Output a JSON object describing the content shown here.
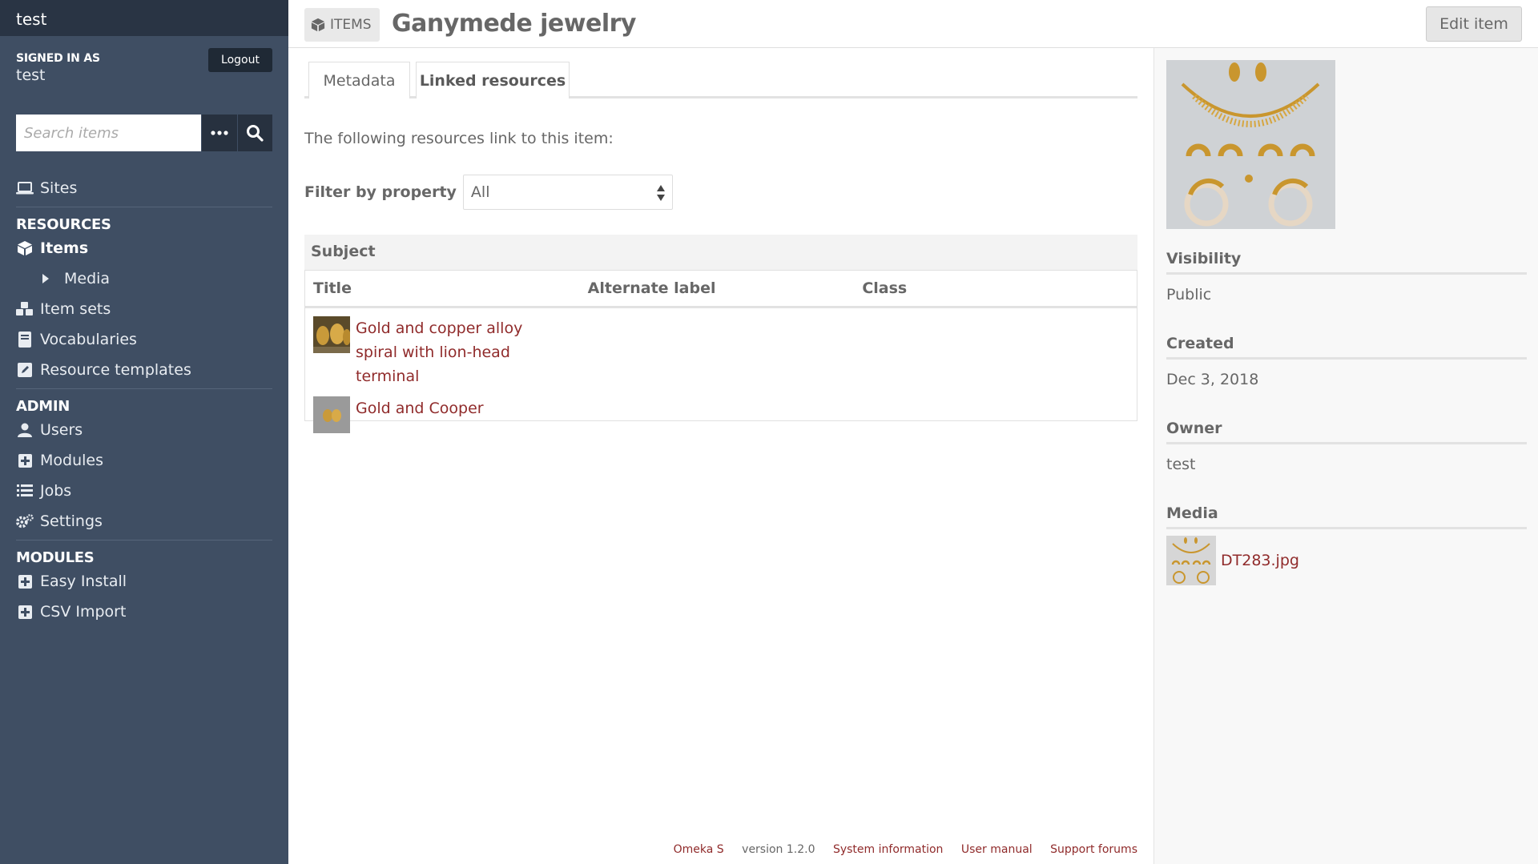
{
  "sidebar": {
    "site_title": "test",
    "signed_in_label": "SIGNED IN AS",
    "signed_in_user": "test",
    "logout_label": "Logout",
    "search_placeholder": "Search items",
    "sites_label": "Sites",
    "resources_heading": "RESOURCES",
    "items_label": "Items",
    "media_label": "Media",
    "item_sets_label": "Item sets",
    "vocabularies_label": "Vocabularies",
    "resource_templates_label": "Resource templates",
    "admin_heading": "ADMIN",
    "users_label": "Users",
    "modules_label": "Modules",
    "jobs_label": "Jobs",
    "settings_label": "Settings",
    "modules_heading": "MODULES",
    "easy_install_label": "Easy Install",
    "csv_import_label": "CSV Import"
  },
  "header": {
    "section_badge": "ITEMS",
    "title": "Ganymede jewelry",
    "edit_label": "Edit item"
  },
  "tabs": {
    "metadata": "Metadata",
    "linked": "Linked resources"
  },
  "linked": {
    "intro": "The following resources link to this item:",
    "filter_label": "Filter by property",
    "filter_value": "All",
    "group_heading": "Subject",
    "columns": [
      "Title",
      "Alternate label",
      "Class"
    ],
    "rows": [
      {
        "title": "Gold and copper alloy spiral with lion-head terminal"
      },
      {
        "title": "Gold and Cooper"
      }
    ]
  },
  "panel": {
    "visibility_label": "Visibility",
    "visibility_value": "Public",
    "created_label": "Created",
    "created_value": "Dec 3, 2018",
    "owner_label": "Owner",
    "owner_value": "test",
    "media_label": "Media",
    "media_file": "DT283.jpg"
  },
  "footer": {
    "brand": "Omeka S",
    "version": "version 1.2.0",
    "system_info": "System information",
    "user_manual": "User manual",
    "support": "Support forums"
  },
  "colors": {
    "sidebar_bg": "#3f4e63",
    "sidebar_top": "#293444",
    "link": "#902b2b",
    "text": "#676767"
  }
}
